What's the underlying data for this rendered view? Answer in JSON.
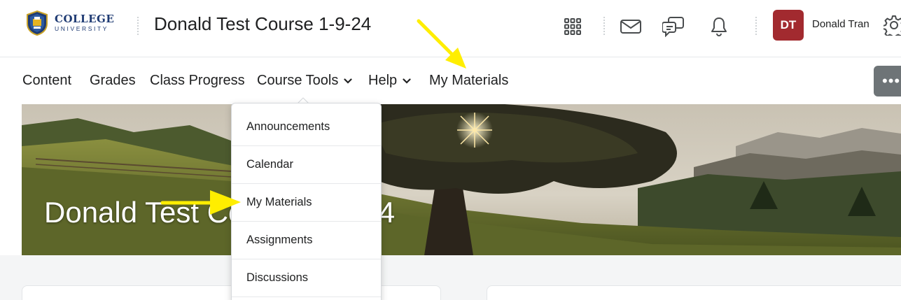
{
  "header": {
    "logo": {
      "college": "COLLEGE",
      "university": "UNIVERSITY"
    },
    "course_title": "Donald Test Course 1-9-24",
    "icons": [
      "waffle-grid-icon",
      "mail-icon",
      "chat-icon",
      "bell-icon",
      "gear-icon"
    ],
    "user": {
      "initials": "DT",
      "name": "Donald Tran",
      "avatar_color": "#a22a2f"
    }
  },
  "navbar": {
    "items": [
      {
        "label": "Content"
      },
      {
        "label": "Grades"
      },
      {
        "label": "Class Progress"
      },
      {
        "label": "Course Tools",
        "has_menu": true
      },
      {
        "label": "Help",
        "has_menu": true
      },
      {
        "label": "My Materials"
      }
    ],
    "more_label": "•••"
  },
  "banner": {
    "title": "Donald Test Course 1-9-24"
  },
  "dropdown": {
    "items": [
      {
        "label": "Announcements"
      },
      {
        "label": "Calendar"
      },
      {
        "label": "My Materials"
      },
      {
        "label": "Assignments"
      },
      {
        "label": "Discussions"
      }
    ]
  },
  "annotations": {
    "arrow_color": "#ffee00"
  }
}
